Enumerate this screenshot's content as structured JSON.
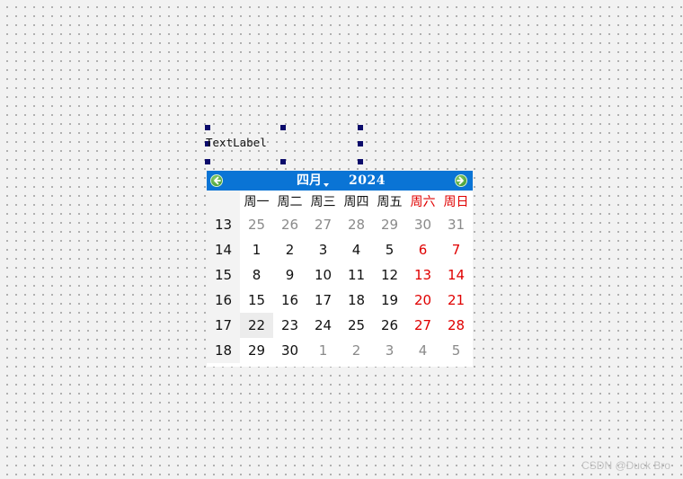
{
  "text_label": "TextLabel",
  "calendar": {
    "month_label": "四月",
    "year_label": "2024",
    "weekday_headers": [
      {
        "label": "周一",
        "weekend": false
      },
      {
        "label": "周二",
        "weekend": false
      },
      {
        "label": "周三",
        "weekend": false
      },
      {
        "label": "周四",
        "weekend": false
      },
      {
        "label": "周五",
        "weekend": false
      },
      {
        "label": "周六",
        "weekend": true
      },
      {
        "label": "周日",
        "weekend": true
      }
    ],
    "selected_day": "22",
    "weeks": [
      {
        "week": "13",
        "days": [
          {
            "d": "25",
            "outside": true,
            "weekend": false
          },
          {
            "d": "26",
            "outside": true,
            "weekend": false
          },
          {
            "d": "27",
            "outside": true,
            "weekend": false
          },
          {
            "d": "28",
            "outside": true,
            "weekend": false
          },
          {
            "d": "29",
            "outside": true,
            "weekend": false
          },
          {
            "d": "30",
            "outside": true,
            "weekend": true
          },
          {
            "d": "31",
            "outside": true,
            "weekend": true
          }
        ]
      },
      {
        "week": "14",
        "days": [
          {
            "d": "1",
            "outside": false,
            "weekend": false
          },
          {
            "d": "2",
            "outside": false,
            "weekend": false
          },
          {
            "d": "3",
            "outside": false,
            "weekend": false
          },
          {
            "d": "4",
            "outside": false,
            "weekend": false
          },
          {
            "d": "5",
            "outside": false,
            "weekend": false
          },
          {
            "d": "6",
            "outside": false,
            "weekend": true
          },
          {
            "d": "7",
            "outside": false,
            "weekend": true
          }
        ]
      },
      {
        "week": "15",
        "days": [
          {
            "d": "8",
            "outside": false,
            "weekend": false
          },
          {
            "d": "9",
            "outside": false,
            "weekend": false
          },
          {
            "d": "10",
            "outside": false,
            "weekend": false
          },
          {
            "d": "11",
            "outside": false,
            "weekend": false
          },
          {
            "d": "12",
            "outside": false,
            "weekend": false
          },
          {
            "d": "13",
            "outside": false,
            "weekend": true
          },
          {
            "d": "14",
            "outside": false,
            "weekend": true
          }
        ]
      },
      {
        "week": "16",
        "days": [
          {
            "d": "15",
            "outside": false,
            "weekend": false
          },
          {
            "d": "16",
            "outside": false,
            "weekend": false
          },
          {
            "d": "17",
            "outside": false,
            "weekend": false
          },
          {
            "d": "18",
            "outside": false,
            "weekend": false
          },
          {
            "d": "19",
            "outside": false,
            "weekend": false
          },
          {
            "d": "20",
            "outside": false,
            "weekend": true
          },
          {
            "d": "21",
            "outside": false,
            "weekend": true
          }
        ]
      },
      {
        "week": "17",
        "days": [
          {
            "d": "22",
            "outside": false,
            "weekend": false
          },
          {
            "d": "23",
            "outside": false,
            "weekend": false
          },
          {
            "d": "24",
            "outside": false,
            "weekend": false
          },
          {
            "d": "25",
            "outside": false,
            "weekend": false
          },
          {
            "d": "26",
            "outside": false,
            "weekend": false
          },
          {
            "d": "27",
            "outside": false,
            "weekend": true
          },
          {
            "d": "28",
            "outside": false,
            "weekend": true
          }
        ]
      },
      {
        "week": "18",
        "days": [
          {
            "d": "29",
            "outside": false,
            "weekend": false
          },
          {
            "d": "30",
            "outside": false,
            "weekend": false
          },
          {
            "d": "1",
            "outside": true,
            "weekend": false
          },
          {
            "d": "2",
            "outside": true,
            "weekend": false
          },
          {
            "d": "3",
            "outside": true,
            "weekend": false
          },
          {
            "d": "4",
            "outside": true,
            "weekend": true
          },
          {
            "d": "5",
            "outside": true,
            "weekend": true
          }
        ]
      }
    ]
  },
  "watermark": "CSDN @Duck Bro",
  "colors": {
    "header_bg": "#0a74d5",
    "weekend_text": "#e00000",
    "outside_text": "#8a8a8a",
    "selection_handle": "#0b0b6b",
    "nav_button_green": "#2f8a22"
  },
  "icons": {
    "prev_month": "arrow-left-circle-icon",
    "next_month": "arrow-right-circle-icon",
    "month_dropdown": "caret-down-icon"
  }
}
